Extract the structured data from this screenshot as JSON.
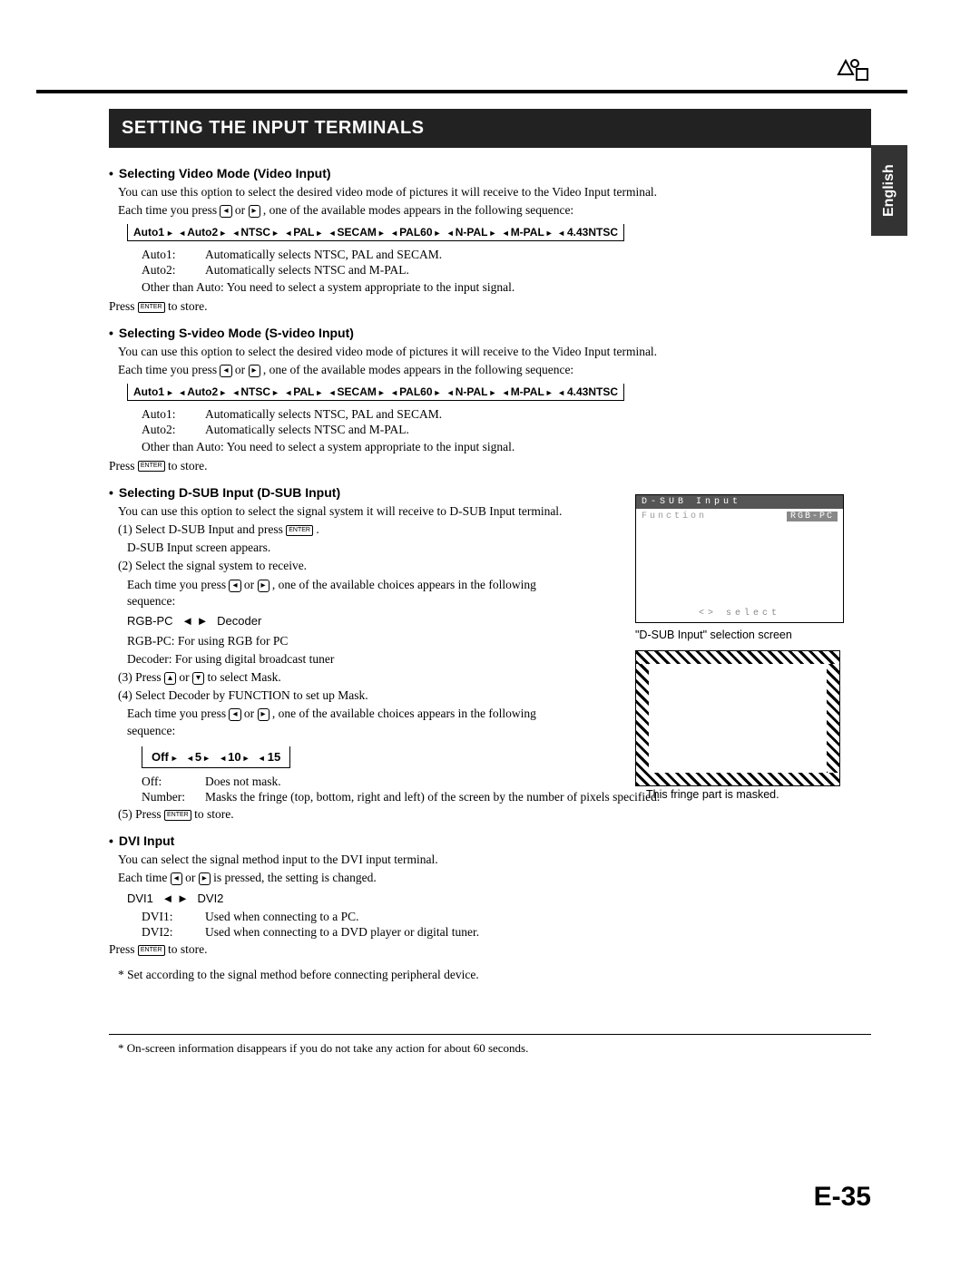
{
  "header": {
    "language_tab": "English",
    "title": "SETTING THE INPUT TERMINALS"
  },
  "video_mode": {
    "heading": "Selecting Video Mode (Video Input)",
    "desc": "You can use this option to select the desired video mode of pictures it will receive to the Video Input terminal.",
    "press_line_a": "Each time you press ",
    "press_line_b": " or ",
    "press_line_c": ", one of the available modes appears in the following sequence:",
    "seq": [
      "Auto1",
      "Auto2",
      "NTSC",
      "PAL",
      "SECAM",
      "PAL60",
      "N-PAL",
      "M-PAL",
      "4.43NTSC"
    ],
    "auto1": "Automatically selects NTSC, PAL and SECAM.",
    "auto2": "Automatically selects NTSC and M-PAL.",
    "other": "Other than Auto: You need to select a system appropriate to the input signal.",
    "store_a": "Press ",
    "store_b": " to store."
  },
  "svideo_mode": {
    "heading": "Selecting S-video Mode (S-video Input)",
    "desc": "You can use this option to select the desired video mode of pictures it will receive to the Video Input terminal.",
    "press_line_a": "Each time you press ",
    "press_line_b": " or ",
    "press_line_c": ", one of the available modes appears in the following sequence:",
    "seq": [
      "Auto1",
      "Auto2",
      "NTSC",
      "PAL",
      "SECAM",
      "PAL60",
      "N-PAL",
      "M-PAL",
      "4.43NTSC"
    ],
    "auto1": "Automatically selects NTSC, PAL and SECAM.",
    "auto2": "Automatically selects NTSC and M-PAL.",
    "other": "Other than Auto: You need to select a system appropriate to the input signal.",
    "store_a": "Press ",
    "store_b": " to store."
  },
  "dsub": {
    "heading": "Selecting D-SUB Input (D-SUB Input)",
    "desc": "You can use this option to select the signal system it will receive to D-SUB Input terminal.",
    "s1a": "(1) Select D-SUB Input and press ",
    "s1b": ".",
    "s1c": "D-SUB Input screen appears.",
    "s2": "(2) Select the signal system to receive.",
    "s2b_a": "Each time you press ",
    "s2b_b": " or ",
    "s2b_c": ", one of the available choices appears in the following sequence:",
    "seq2": [
      "RGB-PC",
      "Decoder"
    ],
    "d1": "RGB-PC: For using RGB for PC",
    "d2": "Decoder: For using digital broadcast tuner",
    "s3a": "(3) Press ",
    "s3b": " or ",
    "s3c": " to select Mask.",
    "s4": "(4) Select Decoder by FUNCTION to set up Mask.",
    "s4b_a": "Each time you press ",
    "s4b_b": " or ",
    "s4b_c": ", one of the available choices appears in the following sequence:",
    "seq3": [
      "Off",
      "5",
      "10",
      "15"
    ],
    "off_key": "Off:",
    "off_val": "Does not mask.",
    "num_key": "Number:",
    "num_val": "Masks the fringe (top, bottom, right and left) of the screen by the number of pixels specified.",
    "s5a": "(5) Press ",
    "s5b": " to store."
  },
  "dvi": {
    "heading": "DVI Input",
    "desc": "You can select the signal method input to the DVI input terminal.",
    "press_a": "Each time ",
    "press_b": " or ",
    "press_c": " is pressed, the setting is changed.",
    "seq": [
      "DVI1",
      "DVI2"
    ],
    "dvi1_key": "DVI1:",
    "dvi1_val": "Used when connecting to a PC.",
    "dvi2_key": "DVI2:",
    "dvi2_val": "Used when connecting to a DVD player or digital tuner.",
    "store_a": "Press ",
    "store_b": " to store.",
    "note": "* Set according to the signal method before connecting peripheral device."
  },
  "right": {
    "osd_title": "D-SUB Input",
    "osd_func": "Function",
    "osd_val": "RGB-PC",
    "osd_hint": "<> select",
    "osd_caption": "\"D-SUB Input\" selection screen",
    "fringe_caption": "This fringe part is masked."
  },
  "footnote": "* On-screen information disappears if you do not take any action for about 60 seconds.",
  "page_number": "E-35",
  "icons": {
    "left_btn": "◂",
    "right_btn": "▸",
    "up_btn": "▴",
    "down_btn": "▾",
    "enter_btn": "ENTER"
  }
}
